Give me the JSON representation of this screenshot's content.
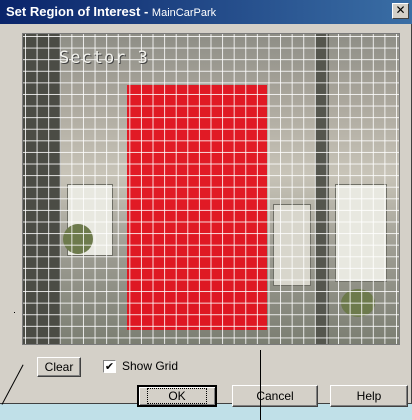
{
  "window": {
    "title": "Set Region of Interest",
    "title_separator": " - ",
    "subtitle": "MainCarPark",
    "close_glyph": "✕"
  },
  "camera": {
    "overlay_label": "Sector 3",
    "grid_visible": true,
    "region_color": "#e3121e"
  },
  "controls": {
    "clear_label": "Clear",
    "show_grid_label": "Show Grid",
    "show_grid_checked": true,
    "check_glyph": "✔",
    "ok_label": "OK",
    "cancel_label": "Cancel",
    "help_label": "Help"
  },
  "colors": {
    "titlebar_start": "#0a246a",
    "titlebar_end": "#3a6ea5",
    "dialog_bg": "#d4d0c8",
    "page_bg": "#c0e0e8"
  },
  "icons": [
    "close-icon",
    "checkbox-checked-icon"
  ]
}
